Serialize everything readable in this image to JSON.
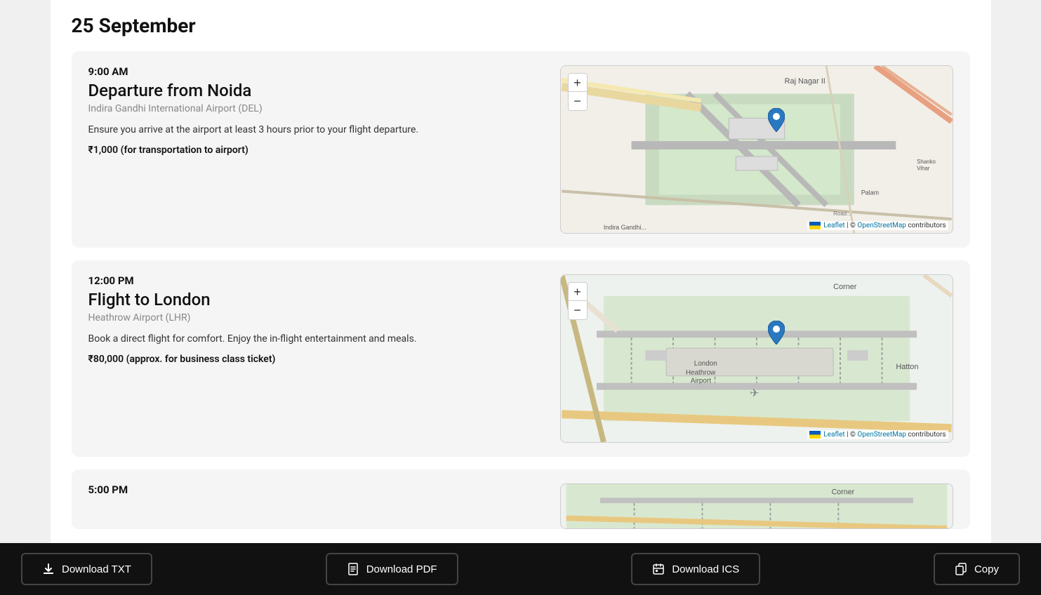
{
  "page": {
    "date": "25 September"
  },
  "events": [
    {
      "id": "dep-noida",
      "time": "9:00 AM",
      "title": "Departure from Noida",
      "location": "Indira Gandhi International Airport (DEL)",
      "description": "Ensure you arrive at the airport at least 3 hours prior to your flight departure.",
      "cost": "₹1,000 (for transportation to airport)",
      "map_type": "del"
    },
    {
      "id": "flight-london",
      "time": "12:00 PM",
      "title": "Flight to London",
      "location": "Heathrow Airport (LHR)",
      "description": "Book a direct flight for comfort. Enjoy the in-flight entertainment and meals.",
      "cost": "₹80,000 (approx. for business class ticket)",
      "map_type": "lhr"
    },
    {
      "id": "arrival",
      "time": "5:00 PM",
      "title": "",
      "location": "",
      "description": "",
      "cost": "",
      "map_type": "lhr_partial"
    }
  ],
  "toolbar": {
    "download_txt": "Download TXT",
    "download_pdf": "Download PDF",
    "download_ics": "Download ICS",
    "copy": "Copy"
  },
  "map": {
    "zoom_in": "+",
    "zoom_out": "−",
    "attribution_leaflet": "Leaflet",
    "attribution_osm": "OpenStreetMap",
    "attribution_suffix": " contributors"
  }
}
